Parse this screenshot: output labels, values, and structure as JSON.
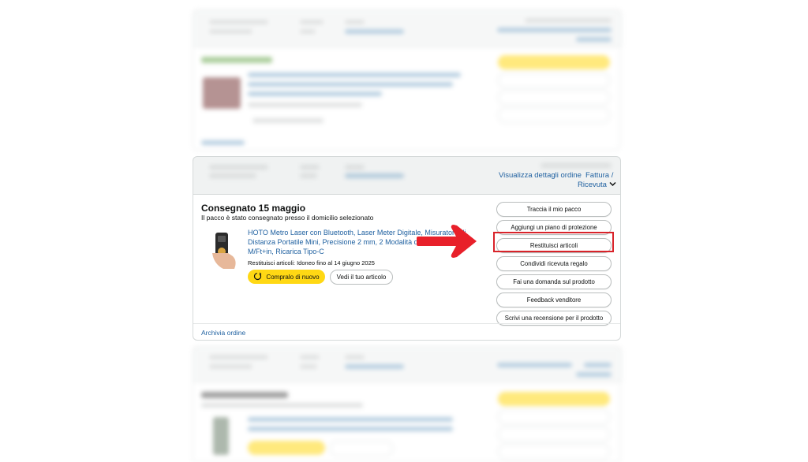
{
  "order": {
    "view_details": "Visualizza dettagli ordine",
    "invoice": "Fattura /",
    "receipt": "Ricevuta",
    "status": "Consegnato 15 maggio",
    "status_detail": "Il pacco è stato consegnato presso il domicilio selezionato",
    "product_title": "HOTO Metro Laser con Bluetooth, Laser Meter Digitale, Misuratore di Distanza Portatile Mini, Precisione 2 mm, 2 Modalità di Misurazione, M/Ft+in, Ricarica Tipo-C",
    "return_eligibility": "Restituisci articoli: Idoneo fino al 14 giugno 2025",
    "buy_again": "Compralo di nuovo",
    "view_item": "Vedi il tuo articolo",
    "archive": "Archivia ordine",
    "actions": [
      "Traccia il mio pacco",
      "Aggiungi un piano di protezione",
      "Restituisci articoli",
      "Condividi ricevuta regalo",
      "Fai una domanda sul prodotto",
      "Feedback venditore",
      "Scrivi una recensione per il prodotto"
    ]
  },
  "colors": {
    "link": "#2162a1",
    "buy_button": "#ffd814",
    "highlight": "#d9232a",
    "arrow": "#e8202a"
  },
  "icons": [
    "chevron-down-icon",
    "arrow-right-icon",
    "refresh-icon"
  ]
}
